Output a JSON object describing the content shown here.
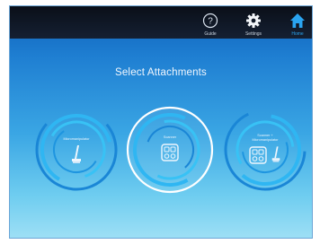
{
  "nav": {
    "guide": {
      "label": "Guide",
      "icon": "question-circle-icon"
    },
    "settings": {
      "label": "Settings",
      "icon": "gear-icon"
    },
    "home": {
      "label": "Home",
      "icon": "home-icon",
      "active_color": "#2aa4f0"
    }
  },
  "screen": {
    "title": "Select Attachments"
  },
  "options": [
    {
      "label": "Micromanipulator",
      "icon": "micromanipulator-icon"
    },
    {
      "label": "Scanner",
      "icon": "scanner-icon",
      "selected": true
    },
    {
      "label_line1": "Scanner +",
      "label_line2": "Micromanipulator",
      "icons": [
        "scanner-icon",
        "micromanipulator-icon"
      ]
    }
  ],
  "colors": {
    "ring": "#2fb6f2",
    "ring_dark": "#1688d8",
    "selected_ring": "#ffffff",
    "topbar": "#0a0f18"
  }
}
